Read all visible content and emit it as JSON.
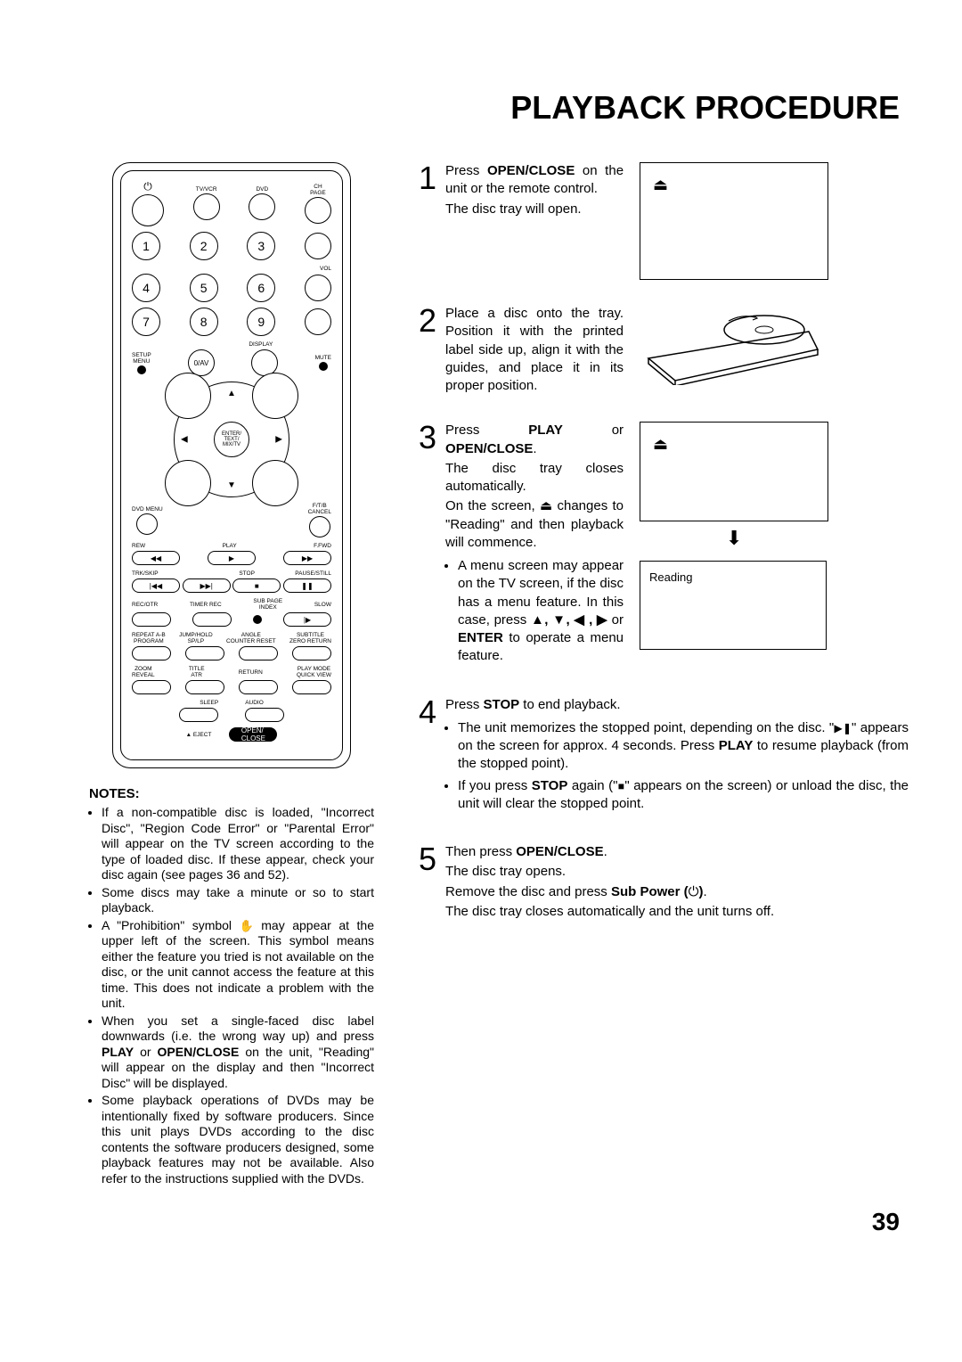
{
  "title": "PLAYBACK PROCEDURE",
  "page_num": "39",
  "remote": {
    "row1": [
      "TV/VCR",
      "DVD",
      "CH\nPAGE"
    ],
    "nums": [
      "1",
      "2",
      "3",
      "4",
      "5",
      "6",
      "7",
      "8",
      "9"
    ],
    "vol": "VOL",
    "display": "DISPLAY",
    "setup": "SETUP\nMENU",
    "zero": "0/AV",
    "mute": "MUTE",
    "enter": "ENTER/\nTEXT/\nMIX/TV",
    "dvdmenu": "DVD MENU",
    "ftb": "F/T/B\nCANCEL",
    "trans": [
      "REW",
      "PLAY",
      "F.FWD"
    ],
    "trk": "TRK/SKIP",
    "stop": "STOP",
    "pause": "PAUSE/STILL",
    "recotr": "REC/OTR",
    "timer": "TIMER REC",
    "subpage": "SUB PAGE\nINDEX",
    "slow": "SLOW",
    "row_small1": [
      "REPEAT A-B\nPROGRAM",
      "JUMP/HOLD\nSP/LP",
      "ANGLE\nCOUNTER RESET",
      "SUBTITLE\nZERO RETURN"
    ],
    "row_small2": [
      "ZOOM\nREVEAL",
      "TITLE\nATR",
      "RETURN",
      "PLAY MODE\nQUICK VIEW"
    ],
    "sleep": "SLEEP",
    "audio": "AUDIO",
    "eject": "EJECT",
    "openclose": "OPEN/\nCLOSE"
  },
  "notes_h": "NOTES:",
  "notes": [
    {
      "pre": "If a non-compatible disc is loaded, \"Incorrect Disc\", \"Region Code Error\" or \"Parental Error\" will appear on the TV screen according to the type of loaded disc. If these appear, check your disc again (see pages 36 and 52)."
    },
    {
      "pre": "Some discs may take a minute or so to start playback."
    },
    {
      "pre": "A \"Prohibition\" symbol ",
      "icon": "✋",
      "post": " may appear at the upper left of the screen. This symbol means either the feature you tried is not available on the disc, or the unit cannot access the feature at this time. This does not indicate a problem with the unit."
    },
    {
      "pre": "When you set a single-faced disc label downwards (i.e. the wrong way up) and press ",
      "b1": "PLAY",
      "mid": " or ",
      "b2": "OPEN/CLOSE",
      "post": " on the unit, \"Reading\" will appear on the display and then \"Incorrect Disc\" will be displayed."
    },
    {
      "pre": "Some playback operations of DVDs may be intentionally fixed by software producers. Since this unit plays DVDs according to the disc contents the software producers designed, some playback features may not be available. Also refer to the instructions supplied with the DVDs."
    }
  ],
  "steps": {
    "s1": {
      "num": "1",
      "pre": "Press ",
      "b": "OPEN/CLOSE",
      "post": " on the unit or the remote control.",
      "line2": "The disc tray will open."
    },
    "s2": {
      "num": "2",
      "text": "Place a disc onto the tray. Position it with the printed label side up, align it with the guides, and place it in its proper position."
    },
    "s3": {
      "num": "3",
      "pre": "Press ",
      "b1": "PLAY",
      "mid": " or ",
      "b2": "OPEN/CLOSE",
      "post": ".",
      "l2": "The disc tray closes automatically.",
      "l3a": "On the screen, ",
      "l3icon": "⏏",
      "l3b": " changes to \"Reading\" and then playback will commence.",
      "bul_a": "A menu screen may appear on the TV screen, if the disc has a menu feature. In this case, press ",
      "arrows": "▲, ▼, ◀ , ▶",
      "or": " or ",
      "enter": "ENTER",
      "bul_b": " to operate a menu feature.",
      "reading": "Reading"
    },
    "s4": {
      "num": "4",
      "pre": "Press ",
      "b": "STOP",
      "post": " to end playback.",
      "li1a": "The unit memorizes the stopped point, depending on the disc. \"",
      "icon1": "▶❚",
      "li1b": "\" appears on the screen for approx. 4 seconds. Press ",
      "b2": "PLAY",
      "li1c": " to resume playback (from the stopped point).",
      "li2a": "If you press ",
      "b3": "STOP",
      "li2b": " again (\"",
      "icon2": "■",
      "li2c": "\" appears on the screen) or unload the disc, the unit will clear the stopped point."
    },
    "s5": {
      "num": "5",
      "pre": "Then press ",
      "b": "OPEN/CLOSE",
      "post": ".",
      "l2": "The disc tray opens.",
      "l3a": "Remove the disc and press ",
      "b2": "Sub Power (",
      "pwricon": "⏻",
      "b2b": ")",
      "l3b": ".",
      "l4": "The disc tray closes automatically and the unit turns off."
    }
  }
}
